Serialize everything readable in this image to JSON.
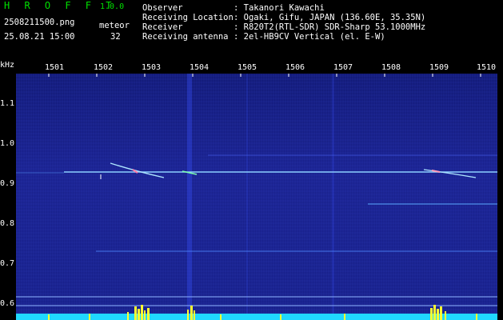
{
  "header": {
    "app_title": "H R O F F T",
    "app_version": "1.0.0",
    "file_name": "2508211500.png",
    "date_time": "25.08.21 15:00",
    "meteor_label": "meteor",
    "meteor_count": "32",
    "info": [
      {
        "label": "Observer",
        "value": ": Takanori Kawachi"
      },
      {
        "label": "Receiving Location",
        "value": ": Ogaki, Gifu, JAPAN (136.60E, 35.35N)"
      },
      {
        "label": "Receiver",
        "value": ": R820T2(RTL-SDR) SDR-Sharp 53.1000MHz"
      },
      {
        "label": "Receiving antenna",
        "value": ": 2el-HB9CV Vertical (el. E-W)"
      }
    ]
  },
  "plot": {
    "y_unit": "kHz",
    "y_ticks": [
      "1.1",
      "1.0",
      "0.9",
      "0.8",
      "0.7",
      "0.6"
    ],
    "x_ticks": [
      "1501",
      "1502",
      "1503",
      "1504",
      "1505",
      "1506",
      "1507",
      "1508",
      "1509",
      "1510"
    ],
    "colors": {
      "background": "#1a2290",
      "carrier": "#80c8ff",
      "activity": "#ffff30",
      "baseline": "#30e0ff"
    }
  }
}
